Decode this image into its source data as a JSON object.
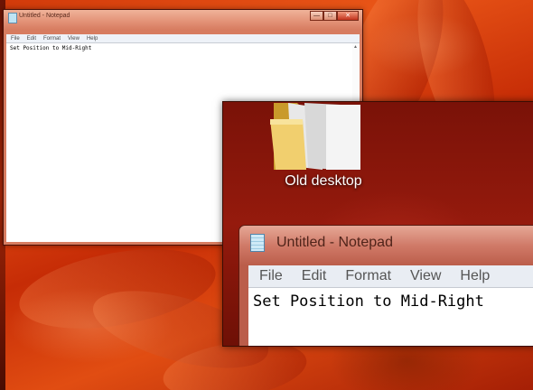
{
  "desktop": {
    "accent_color": "#d23a0a"
  },
  "small_window": {
    "title": "Untitled - Notepad",
    "controls": {
      "minimize": "—",
      "maximize": "□",
      "close": "✕"
    },
    "menu": [
      "File",
      "Edit",
      "Format",
      "View",
      "Help"
    ],
    "content": "Set Position to Mid-Right",
    "scroll_up": "▲"
  },
  "zoom_view": {
    "folder": {
      "label": "Old desktop",
      "icon": "folder-icon"
    },
    "notepad": {
      "title": "Untitled - Notepad",
      "menu": [
        "File",
        "Edit",
        "Format",
        "View",
        "Help"
      ],
      "content": "Set Position to Mid-Right"
    }
  }
}
